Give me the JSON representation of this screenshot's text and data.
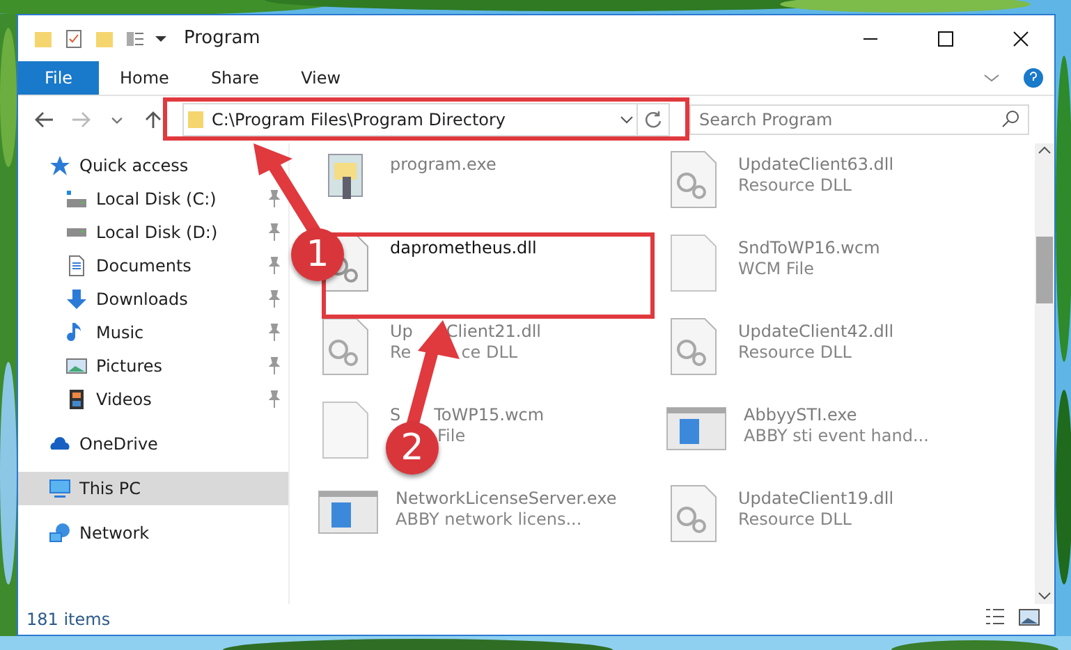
{
  "window": {
    "title": "Program"
  },
  "ribbon_tabs": [
    {
      "label": "File",
      "kind": "file"
    },
    {
      "label": "Home",
      "kind": "tab"
    },
    {
      "label": "Share",
      "kind": "tab"
    },
    {
      "label": "View",
      "kind": "tab"
    }
  ],
  "address_bar": {
    "path": "C:\\Program Files\\Program Directory"
  },
  "search": {
    "placeholder": "Search Program"
  },
  "sidebar": {
    "items": [
      {
        "label": "Quick access",
        "kind": "quick",
        "selected": false,
        "children": [
          {
            "label": "Local Disk (C:)",
            "kind": "system_drive",
            "selected": false,
            "pinned": true
          },
          {
            "label": "Local Disk (D:)",
            "kind": "drive",
            "selected": false,
            "pinned": true
          },
          {
            "label": "Documents",
            "kind": "documents",
            "selected": false,
            "pinned": true
          },
          {
            "label": "Downloads",
            "kind": "downloads",
            "selected": false,
            "pinned": true
          },
          {
            "label": "Music",
            "kind": "music",
            "selected": false,
            "pinned": true
          },
          {
            "label": "Pictures",
            "kind": "pictures",
            "selected": false,
            "pinned": true
          },
          {
            "label": "Videos",
            "kind": "videos",
            "selected": false,
            "pinned": true
          }
        ]
      },
      {
        "label": "OneDrive",
        "kind": "cloud",
        "selected": false
      },
      {
        "label": "This PC",
        "kind": "computer",
        "selected": true
      },
      {
        "label": "Network",
        "kind": "network",
        "selected": false
      }
    ]
  },
  "files": [
    {
      "name": "program.exe",
      "kind": "program",
      "blurred": true
    },
    {
      "name": "UpdateClient63.dll",
      "type": "Resource DLL",
      "kind": "dll",
      "blurred": true
    },
    {
      "name": "daprometheus.dll",
      "kind": "dll",
      "blurred": false
    },
    {
      "name": "SndToWP16.wcm",
      "type": "WCM File",
      "kind": "blank",
      "blurred": true
    },
    {
      "name_parts": [
        "Up",
        "Client21.dll"
      ],
      "type_parts": [
        "Re",
        "ce DLL"
      ],
      "kind": "dll",
      "blurred": true
    },
    {
      "name": "UpdateClient42.dll",
      "type": "Resource DLL",
      "kind": "dll",
      "blurred": true
    },
    {
      "name_parts": [
        "S",
        "ToWP15.wcm"
      ],
      "type_parts": [
        "File"
      ],
      "kind": "blank",
      "blurred": true
    },
    {
      "name": "AbbyySTI.exe",
      "type": "ABBY sti event hand...",
      "kind": "app",
      "blurred": true
    },
    {
      "name": "NetworkLicenseServer.exe",
      "type": "ABBY network licens...",
      "kind": "app",
      "blurred": true
    },
    {
      "name": "UpdateClient19.dll",
      "type": "Resource DLL",
      "kind": "dll",
      "blurred": true
    }
  ],
  "status_bar": {
    "count": "181 items"
  },
  "annotations": [
    {
      "label": "1"
    },
    {
      "label": "2"
    }
  ]
}
